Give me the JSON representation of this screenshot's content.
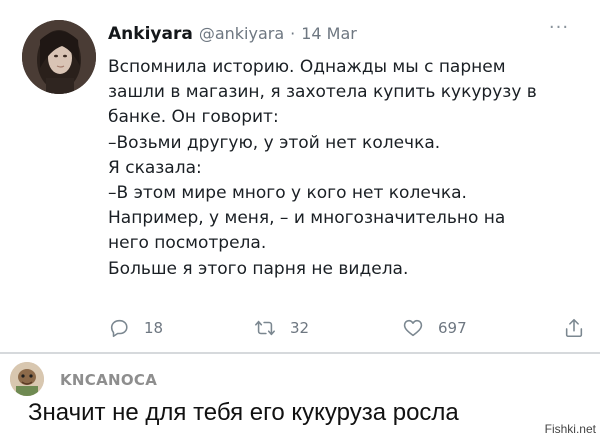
{
  "tweet": {
    "author_name": "Ankiyara",
    "author_handle": "@ankiyara",
    "separator_dot": "·",
    "date": "14 Mar",
    "more_label": "···",
    "lines": [
      "Вспомнила историю. Однажды мы с парнем",
      "зашли в магазин, я захотела купить кукурузу в",
      "банке. Он говорит:",
      "–Возьми другую, у этой нет колечка.",
      "Я сказала:",
      "–В этом мире много у кого нет колечка.",
      "Например, у меня, – и многозначительно на",
      "него посмотрела.",
      "Больше я этого парня не видела."
    ],
    "actions": {
      "reply_count": "18",
      "retweet_count": "32",
      "like_count": "697"
    },
    "icons": {
      "reply": "reply-icon",
      "retweet": "retweet-icon",
      "like": "heart-icon",
      "share": "share-icon",
      "more": "more-icon"
    }
  },
  "comment": {
    "author": "KNCANOCA",
    "text": "Значит не для тебя его кукуруза росла"
  },
  "watermark": "Fishki.net",
  "colors": {
    "text": "#0f1419",
    "muted": "#6e7781",
    "separator": "#d6d9dc",
    "background": "#ffffff"
  }
}
